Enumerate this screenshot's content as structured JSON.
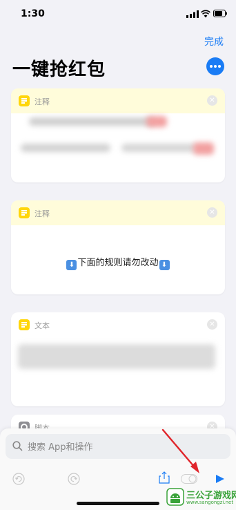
{
  "status_bar": {
    "time": "1:30"
  },
  "nav": {
    "done_label": "完成"
  },
  "page": {
    "title": "一键抢红包"
  },
  "cards": [
    {
      "label": "注释",
      "body_text": ""
    },
    {
      "label": "注释",
      "body_text": "下面的规则请勿改动"
    },
    {
      "label": "文本",
      "body_text": ""
    },
    {
      "label": "脚本",
      "body_text": ""
    }
  ],
  "search": {
    "placeholder": "搜索 App和操作"
  },
  "emoji": {
    "down_arrow": "⬇"
  },
  "icons": {
    "card_note": "doc-lines-icon",
    "card_script": "gear-icon",
    "close": "close-icon",
    "search": "search-icon",
    "undo": "undo-icon",
    "redo": "redo-icon",
    "share": "share-icon",
    "toggle": "toggle-icon",
    "play": "play-icon"
  },
  "colors": {
    "accent": "#1a7cf5",
    "note_header": "#fffcda",
    "note_icon": "#ffd60a",
    "annotation_arrow": "#e0252b"
  },
  "watermark": {
    "title": "三公子游戏网",
    "url": "www.sangongzi.net"
  }
}
